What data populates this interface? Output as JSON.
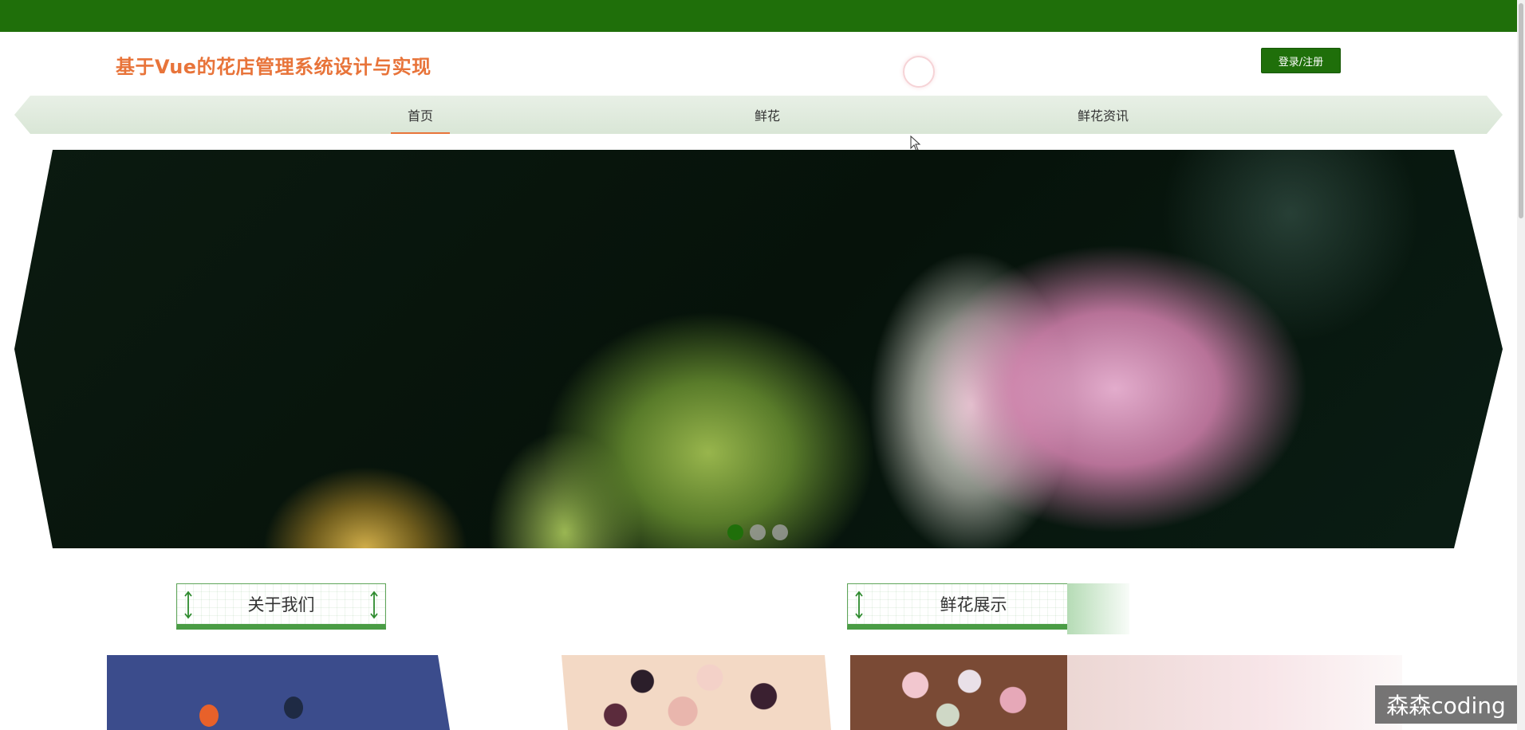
{
  "header": {
    "site_title": "基于Vue的花店管理系统设计与实现",
    "login_label": "登录/注册"
  },
  "nav": {
    "items": [
      {
        "label": "首页",
        "active": true
      },
      {
        "label": "鲜花",
        "active": false
      },
      {
        "label": "鲜花资讯",
        "active": false
      }
    ]
  },
  "carousel": {
    "slide_count": 3,
    "active_index": 0
  },
  "sections": {
    "about_title": "关于我们",
    "flowers_title": "鲜花展示"
  },
  "watermark": "森森coding",
  "colors": {
    "topbar": "#1f6f0a",
    "title": "#e8743a",
    "accent": "#4a9c45"
  }
}
